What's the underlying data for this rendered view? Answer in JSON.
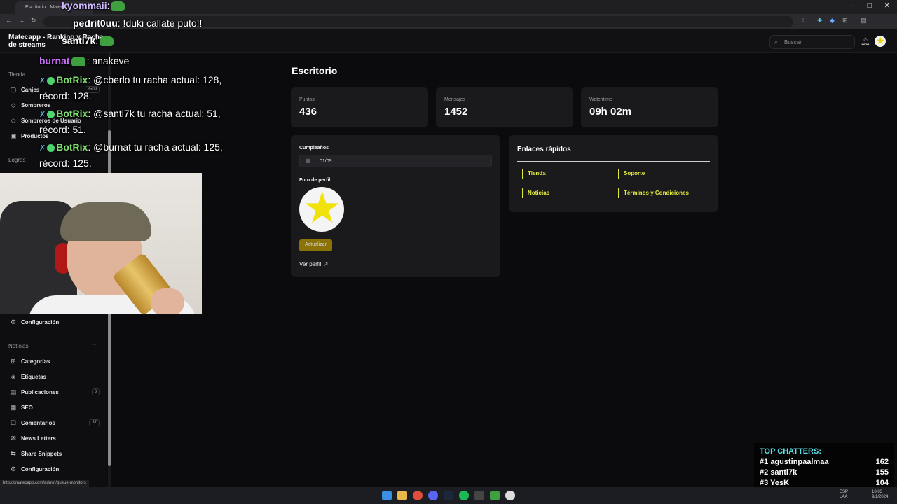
{
  "browser": {
    "tab_title": "Escritorio · Matecapp",
    "status_url": "https://matecapp.com/admin/queue-monitors"
  },
  "header": {
    "brand_line1": "Matecapp - Ranking y Racha",
    "brand_line2": "de streams",
    "search_placeholder": "Buscar"
  },
  "sidebar": {
    "sections": {
      "tienda": "Tienda",
      "logros": "Logros",
      "noticias": "Noticias"
    },
    "items": [
      {
        "label": "Canjes",
        "icon": "bag-icon",
        "badge": "8509"
      },
      {
        "label": "Sombreros",
        "icon": "hat-icon",
        "badge": ""
      },
      {
        "label": "Sombreros de Usuario",
        "icon": "hat-icon",
        "badge": ""
      },
      {
        "label": "Productos",
        "icon": "box-icon",
        "badge": ""
      },
      {
        "label": "Configuración",
        "icon": "gear-icon",
        "badge": ""
      },
      {
        "label": "Categorías",
        "icon": "grid-icon",
        "badge": ""
      },
      {
        "label": "Etiquetas",
        "icon": "tag-icon",
        "badge": ""
      },
      {
        "label": "Publicaciones",
        "icon": "doc-icon",
        "badge": "3"
      },
      {
        "label": "SEO",
        "icon": "seo-icon",
        "badge": ""
      },
      {
        "label": "Comentarios",
        "icon": "comment-icon",
        "badge": "37"
      },
      {
        "label": "News Letters",
        "icon": "mail-icon",
        "badge": ""
      },
      {
        "label": "Share Snippets",
        "icon": "share-icon",
        "badge": ""
      },
      {
        "label": "Configuración",
        "icon": "gear-icon",
        "badge": ""
      }
    ]
  },
  "main": {
    "title": "Escritorio",
    "stats": [
      {
        "label": "Puntos",
        "value": "436"
      },
      {
        "label": "Mensajes",
        "value": "1452"
      },
      {
        "label": "Watchtime",
        "value": "09h 02m"
      }
    ],
    "profile_card": {
      "birthday_label": "Cumpleaños",
      "birthday_value": "01/09",
      "photo_label": "Foto de perfil",
      "update_button": "Actualizar",
      "view_profile": "Ver perfil"
    },
    "quick_links": {
      "title": "Enlaces rápidos",
      "links": [
        "Tienda",
        "Soporte",
        "Noticias",
        "Términos y Condiciones"
      ],
      "accent": "#e4ea3c"
    }
  },
  "stream_overlay": {
    "chat": [
      {
        "user": "kyommaii",
        "text": ":",
        "color": "#d0b8ff"
      },
      {
        "user": "pedrit0uu",
        "text": ": !duki callate puto!!",
        "color": "#ffffff"
      },
      {
        "user": "santi7k",
        "text": ":",
        "color": "#ffffff"
      },
      {
        "user": "burnat",
        "text": ": anakeve",
        "color": "#c46ef0"
      },
      {
        "user": "BotRix",
        "text": ": @cberlo tu racha actual: 128,",
        "text2": "récord: 128.",
        "color": "#7ee06e"
      },
      {
        "user": "BotRix",
        "text": ": @santi7k tu racha actual: 51,",
        "text2": "récord: 51.",
        "color": "#7ee06e"
      },
      {
        "user": "BotRix",
        "text": ": @burnat tu racha actual: 125,",
        "text2": "récord: 125.",
        "color": "#7ee06e"
      }
    ],
    "top_chatters": {
      "title": "TOP CHATTERS:",
      "rows": [
        {
          "rank": "#1",
          "name": "agustinpaalmaa",
          "count": "162"
        },
        {
          "rank": "#2",
          "name": "santi7k",
          "count": "155"
        },
        {
          "rank": "#3",
          "name": "YesK",
          "count": "104"
        }
      ]
    }
  },
  "taskbar": {
    "lang": "ESP",
    "lang2": "LAA",
    "time": "18:03",
    "date": "9/1/2024"
  }
}
